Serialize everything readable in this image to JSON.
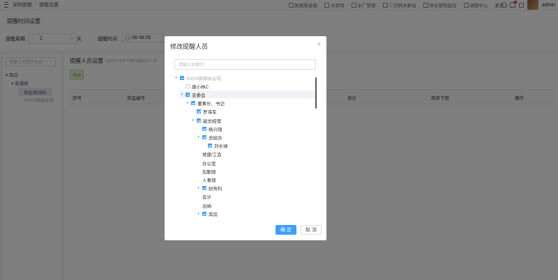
{
  "breadcrumb": [
    "采购提醒",
    "提醒设置"
  ],
  "topnav": [
    "数据看驶舱",
    "水源地",
    "水厂管理",
    "二次供水泵站",
    "供水管网监控",
    "调度中心",
    "更多"
  ],
  "user": {
    "name": "admin",
    "notifications": "2"
  },
  "page": {
    "title": "提醒时间设置",
    "cycle_label": "提醒周期",
    "cycle_value": "2",
    "cycle_unit": "天",
    "time_label": "提醒时间",
    "time_value": "08:48:26",
    "stepper_minus": "−",
    "stepper_plus": "+"
  },
  "left": {
    "search_placeholder": "请输入关键字查询",
    "tree": [
      "库房",
      "普通类",
      "供应商材料",
      "XXXX供排水库"
    ]
  },
  "main": {
    "title": "提醒人员设置",
    "hint": "当前选于库存下限时提醒以下人员",
    "add_label": "添加",
    "columns": [
      "序号",
      "货品编号",
      "单位",
      "库存下限",
      "操作"
    ]
  },
  "modal": {
    "title": "修改提醒人员",
    "close": "×",
    "search_placeholder": "请输入关键字",
    "tree": [
      {
        "label": "XXXX供排水公司",
        "level": 0,
        "arrow": "down",
        "check": "partial",
        "blur": true
      },
      {
        "label": "唐小林C",
        "level": 1,
        "arrow": "",
        "check": "none"
      },
      {
        "label": "支委会",
        "level": 1,
        "arrow": "down",
        "check": "partial",
        "highlight": true
      },
      {
        "label": "董事长、书记",
        "level": 2,
        "arrow": "down",
        "check": "checked"
      },
      {
        "label": "罗海军",
        "level": 3,
        "arrow": "",
        "check": "checked"
      },
      {
        "label": "副总经理",
        "level": 3,
        "arrow": "down",
        "check": "checked"
      },
      {
        "label": "杨兴强",
        "level": 4,
        "arrow": "",
        "check": "checked"
      },
      {
        "label": "总经办",
        "level": 4,
        "arrow": "down",
        "check": "checked"
      },
      {
        "label": "刘长禄",
        "level": 5,
        "arrow": "",
        "check": "checked"
      },
      {
        "label": "党建/工会",
        "level": 4,
        "arrow": "",
        "check": ""
      },
      {
        "label": "办公室",
        "level": 4,
        "arrow": "",
        "check": ""
      },
      {
        "label": "后勤部",
        "level": 4,
        "arrow": "",
        "check": ""
      },
      {
        "label": "人事部",
        "level": 4,
        "arrow": "",
        "check": ""
      },
      {
        "label": "财务科",
        "level": 4,
        "arrow": "down",
        "check": "checked"
      },
      {
        "label": "会计",
        "level": 4,
        "arrow": "",
        "check": ""
      },
      {
        "label": "出纳",
        "level": 4,
        "arrow": "",
        "check": ""
      },
      {
        "label": "库房",
        "level": 4,
        "arrow": "down",
        "check": "checked"
      }
    ],
    "ok_label": "确 定",
    "cancel_label": "取 消"
  }
}
